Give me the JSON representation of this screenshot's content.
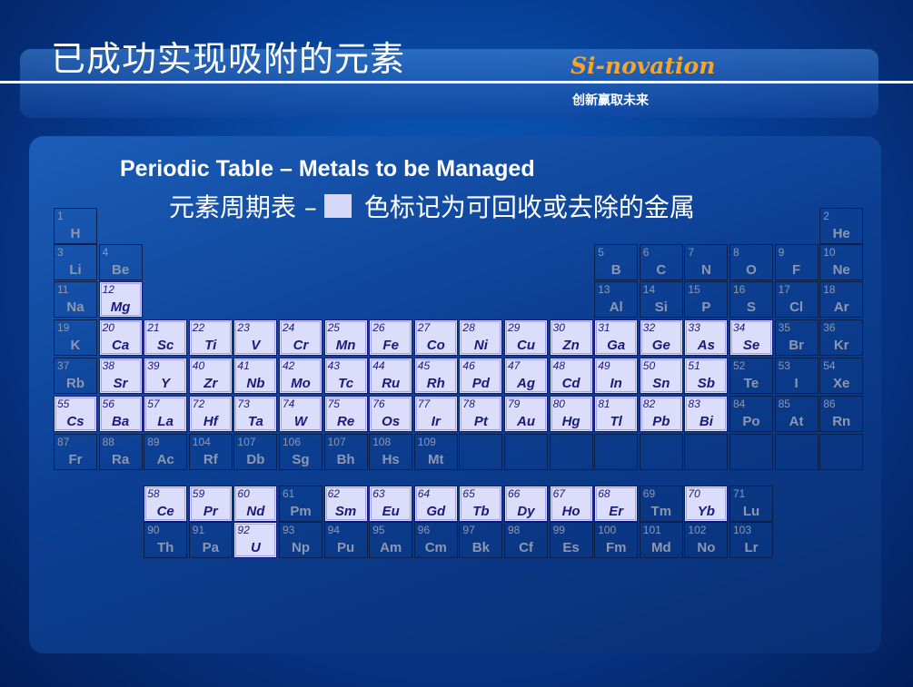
{
  "slide": {
    "title": "已成功实现吸附的元素",
    "brand": "Si-novation",
    "slogan": "创新赢取未来",
    "heading_en": "Periodic Table – Metals to be Managed",
    "heading_cn_left": "元素周期表 –",
    "heading_cn_right": "色标记为可回收或去除的金属"
  },
  "colors": {
    "highlight_fill": "#dcdcfb",
    "highlight_text": "#1a1a7a",
    "dim_text": "#8d98b0",
    "brand": "#f5a52a"
  },
  "elements": [
    {
      "n": "1",
      "s": "H",
      "r": 0,
      "c": 0,
      "hl": false
    },
    {
      "n": "2",
      "s": "He",
      "r": 0,
      "c": 17,
      "hl": false
    },
    {
      "n": "3",
      "s": "Li",
      "r": 1,
      "c": 0,
      "hl": false
    },
    {
      "n": "4",
      "s": "Be",
      "r": 1,
      "c": 1,
      "hl": false
    },
    {
      "n": "5",
      "s": "B",
      "r": 1,
      "c": 12,
      "hl": false
    },
    {
      "n": "6",
      "s": "C",
      "r": 1,
      "c": 13,
      "hl": false
    },
    {
      "n": "7",
      "s": "N",
      "r": 1,
      "c": 14,
      "hl": false
    },
    {
      "n": "8",
      "s": "O",
      "r": 1,
      "c": 15,
      "hl": false
    },
    {
      "n": "9",
      "s": "F",
      "r": 1,
      "c": 16,
      "hl": false
    },
    {
      "n": "10",
      "s": "Ne",
      "r": 1,
      "c": 17,
      "hl": false
    },
    {
      "n": "11",
      "s": "Na",
      "r": 2,
      "c": 0,
      "hl": false
    },
    {
      "n": "12",
      "s": "Mg",
      "r": 2,
      "c": 1,
      "hl": true
    },
    {
      "n": "13",
      "s": "Al",
      "r": 2,
      "c": 12,
      "hl": false
    },
    {
      "n": "14",
      "s": "Si",
      "r": 2,
      "c": 13,
      "hl": false
    },
    {
      "n": "15",
      "s": "P",
      "r": 2,
      "c": 14,
      "hl": false
    },
    {
      "n": "16",
      "s": "S",
      "r": 2,
      "c": 15,
      "hl": false
    },
    {
      "n": "17",
      "s": "Cl",
      "r": 2,
      "c": 16,
      "hl": false
    },
    {
      "n": "18",
      "s": "Ar",
      "r": 2,
      "c": 17,
      "hl": false
    },
    {
      "n": "19",
      "s": "K",
      "r": 3,
      "c": 0,
      "hl": false
    },
    {
      "n": "20",
      "s": "Ca",
      "r": 3,
      "c": 1,
      "hl": true
    },
    {
      "n": "21",
      "s": "Sc",
      "r": 3,
      "c": 2,
      "hl": true
    },
    {
      "n": "22",
      "s": "Ti",
      "r": 3,
      "c": 3,
      "hl": true
    },
    {
      "n": "23",
      "s": "V",
      "r": 3,
      "c": 4,
      "hl": true
    },
    {
      "n": "24",
      "s": "Cr",
      "r": 3,
      "c": 5,
      "hl": true
    },
    {
      "n": "25",
      "s": "Mn",
      "r": 3,
      "c": 6,
      "hl": true
    },
    {
      "n": "26",
      "s": "Fe",
      "r": 3,
      "c": 7,
      "hl": true
    },
    {
      "n": "27",
      "s": "Co",
      "r": 3,
      "c": 8,
      "hl": true
    },
    {
      "n": "28",
      "s": "Ni",
      "r": 3,
      "c": 9,
      "hl": true
    },
    {
      "n": "29",
      "s": "Cu",
      "r": 3,
      "c": 10,
      "hl": true
    },
    {
      "n": "30",
      "s": "Zn",
      "r": 3,
      "c": 11,
      "hl": true
    },
    {
      "n": "31",
      "s": "Ga",
      "r": 3,
      "c": 12,
      "hl": true
    },
    {
      "n": "32",
      "s": "Ge",
      "r": 3,
      "c": 13,
      "hl": true
    },
    {
      "n": "33",
      "s": "As",
      "r": 3,
      "c": 14,
      "hl": true
    },
    {
      "n": "34",
      "s": "Se",
      "r": 3,
      "c": 15,
      "hl": true
    },
    {
      "n": "35",
      "s": "Br",
      "r": 3,
      "c": 16,
      "hl": false
    },
    {
      "n": "36",
      "s": "Kr",
      "r": 3,
      "c": 17,
      "hl": false
    },
    {
      "n": "37",
      "s": "Rb",
      "r": 4,
      "c": 0,
      "hl": false
    },
    {
      "n": "38",
      "s": "Sr",
      "r": 4,
      "c": 1,
      "hl": true
    },
    {
      "n": "39",
      "s": "Y",
      "r": 4,
      "c": 2,
      "hl": true
    },
    {
      "n": "40",
      "s": "Zr",
      "r": 4,
      "c": 3,
      "hl": true
    },
    {
      "n": "41",
      "s": "Nb",
      "r": 4,
      "c": 4,
      "hl": true
    },
    {
      "n": "42",
      "s": "Mo",
      "r": 4,
      "c": 5,
      "hl": true
    },
    {
      "n": "43",
      "s": "Tc",
      "r": 4,
      "c": 6,
      "hl": true
    },
    {
      "n": "44",
      "s": "Ru",
      "r": 4,
      "c": 7,
      "hl": true
    },
    {
      "n": "45",
      "s": "Rh",
      "r": 4,
      "c": 8,
      "hl": true
    },
    {
      "n": "46",
      "s": "Pd",
      "r": 4,
      "c": 9,
      "hl": true
    },
    {
      "n": "47",
      "s": "Ag",
      "r": 4,
      "c": 10,
      "hl": true
    },
    {
      "n": "48",
      "s": "Cd",
      "r": 4,
      "c": 11,
      "hl": true
    },
    {
      "n": "49",
      "s": "In",
      "r": 4,
      "c": 12,
      "hl": true
    },
    {
      "n": "50",
      "s": "Sn",
      "r": 4,
      "c": 13,
      "hl": true
    },
    {
      "n": "51",
      "s": "Sb",
      "r": 4,
      "c": 14,
      "hl": true
    },
    {
      "n": "52",
      "s": "Te",
      "r": 4,
      "c": 15,
      "hl": false
    },
    {
      "n": "53",
      "s": "I",
      "r": 4,
      "c": 16,
      "hl": false
    },
    {
      "n": "54",
      "s": "Xe",
      "r": 4,
      "c": 17,
      "hl": false
    },
    {
      "n": "55",
      "s": "Cs",
      "r": 5,
      "c": 0,
      "hl": true
    },
    {
      "n": "56",
      "s": "Ba",
      "r": 5,
      "c": 1,
      "hl": true
    },
    {
      "n": "57",
      "s": "La",
      "r": 5,
      "c": 2,
      "hl": true
    },
    {
      "n": "72",
      "s": "Hf",
      "r": 5,
      "c": 3,
      "hl": true
    },
    {
      "n": "73",
      "s": "Ta",
      "r": 5,
      "c": 4,
      "hl": true
    },
    {
      "n": "74",
      "s": "W",
      "r": 5,
      "c": 5,
      "hl": true
    },
    {
      "n": "75",
      "s": "Re",
      "r": 5,
      "c": 6,
      "hl": true
    },
    {
      "n": "76",
      "s": "Os",
      "r": 5,
      "c": 7,
      "hl": true
    },
    {
      "n": "77",
      "s": "Ir",
      "r": 5,
      "c": 8,
      "hl": true
    },
    {
      "n": "78",
      "s": "Pt",
      "r": 5,
      "c": 9,
      "hl": true
    },
    {
      "n": "79",
      "s": "Au",
      "r": 5,
      "c": 10,
      "hl": true
    },
    {
      "n": "80",
      "s": "Hg",
      "r": 5,
      "c": 11,
      "hl": true
    },
    {
      "n": "81",
      "s": "Tl",
      "r": 5,
      "c": 12,
      "hl": true
    },
    {
      "n": "82",
      "s": "Pb",
      "r": 5,
      "c": 13,
      "hl": true
    },
    {
      "n": "83",
      "s": "Bi",
      "r": 5,
      "c": 14,
      "hl": true
    },
    {
      "n": "84",
      "s": "Po",
      "r": 5,
      "c": 15,
      "hl": false
    },
    {
      "n": "85",
      "s": "At",
      "r": 5,
      "c": 16,
      "hl": false
    },
    {
      "n": "86",
      "s": "Rn",
      "r": 5,
      "c": 17,
      "hl": false
    },
    {
      "n": "87",
      "s": "Fr",
      "r": 6,
      "c": 0,
      "hl": false
    },
    {
      "n": "88",
      "s": "Ra",
      "r": 6,
      "c": 1,
      "hl": false
    },
    {
      "n": "89",
      "s": "Ac",
      "r": 6,
      "c": 2,
      "hl": false
    },
    {
      "n": "104",
      "s": "Rf",
      "r": 6,
      "c": 3,
      "hl": false
    },
    {
      "n": "107",
      "s": "Db",
      "r": 6,
      "c": 4,
      "hl": false
    },
    {
      "n": "106",
      "s": "Sg",
      "r": 6,
      "c": 5,
      "hl": false
    },
    {
      "n": "107",
      "s": "Bh",
      "r": 6,
      "c": 6,
      "hl": false
    },
    {
      "n": "108",
      "s": "Hs",
      "r": 6,
      "c": 7,
      "hl": false
    },
    {
      "n": "109",
      "s": "Mt",
      "r": 6,
      "c": 8,
      "hl": false
    },
    {
      "n": "",
      "s": "",
      "r": 6,
      "c": 9,
      "hl": false
    },
    {
      "n": "",
      "s": "",
      "r": 6,
      "c": 10,
      "hl": false
    },
    {
      "n": "",
      "s": "",
      "r": 6,
      "c": 11,
      "hl": false
    },
    {
      "n": "",
      "s": "",
      "r": 6,
      "c": 12,
      "hl": false
    },
    {
      "n": "",
      "s": "",
      "r": 6,
      "c": 13,
      "hl": false
    },
    {
      "n": "",
      "s": "",
      "r": 6,
      "c": 14,
      "hl": false
    },
    {
      "n": "",
      "s": "",
      "r": 6,
      "c": 15,
      "hl": false
    },
    {
      "n": "",
      "s": "",
      "r": 6,
      "c": 16,
      "hl": false
    },
    {
      "n": "",
      "s": "",
      "r": 6,
      "c": 17,
      "hl": false
    },
    {
      "n": "58",
      "s": "Ce",
      "r": 7,
      "c": 2,
      "hl": true
    },
    {
      "n": "59",
      "s": "Pr",
      "r": 7,
      "c": 3,
      "hl": true
    },
    {
      "n": "60",
      "s": "Nd",
      "r": 7,
      "c": 4,
      "hl": true
    },
    {
      "n": "61",
      "s": "Pm",
      "r": 7,
      "c": 5,
      "hl": false
    },
    {
      "n": "62",
      "s": "Sm",
      "r": 7,
      "c": 6,
      "hl": true
    },
    {
      "n": "63",
      "s": "Eu",
      "r": 7,
      "c": 7,
      "hl": true
    },
    {
      "n": "64",
      "s": "Gd",
      "r": 7,
      "c": 8,
      "hl": true
    },
    {
      "n": "65",
      "s": "Tb",
      "r": 7,
      "c": 9,
      "hl": true
    },
    {
      "n": "66",
      "s": "Dy",
      "r": 7,
      "c": 10,
      "hl": true
    },
    {
      "n": "67",
      "s": "Ho",
      "r": 7,
      "c": 11,
      "hl": true
    },
    {
      "n": "68",
      "s": "Er",
      "r": 7,
      "c": 12,
      "hl": true
    },
    {
      "n": "69",
      "s": "Tm",
      "r": 7,
      "c": 13,
      "hl": false
    },
    {
      "n": "70",
      "s": "Yb",
      "r": 7,
      "c": 14,
      "hl": true
    },
    {
      "n": "71",
      "s": "Lu",
      "r": 7,
      "c": 15,
      "hl": false
    },
    {
      "n": "90",
      "s": "Th",
      "r": 8,
      "c": 2,
      "hl": false
    },
    {
      "n": "91",
      "s": "Pa",
      "r": 8,
      "c": 3,
      "hl": false
    },
    {
      "n": "92",
      "s": "U",
      "r": 8,
      "c": 4,
      "hl": true
    },
    {
      "n": "93",
      "s": "Np",
      "r": 8,
      "c": 5,
      "hl": false
    },
    {
      "n": "94",
      "s": "Pu",
      "r": 8,
      "c": 6,
      "hl": false
    },
    {
      "n": "95",
      "s": "Am",
      "r": 8,
      "c": 7,
      "hl": false
    },
    {
      "n": "96",
      "s": "Cm",
      "r": 8,
      "c": 8,
      "hl": false
    },
    {
      "n": "97",
      "s": "Bk",
      "r": 8,
      "c": 9,
      "hl": false
    },
    {
      "n": "98",
      "s": "Cf",
      "r": 8,
      "c": 10,
      "hl": false
    },
    {
      "n": "99",
      "s": "Es",
      "r": 8,
      "c": 11,
      "hl": false
    },
    {
      "n": "100",
      "s": "Fm",
      "r": 8,
      "c": 12,
      "hl": false
    },
    {
      "n": "101",
      "s": "Md",
      "r": 8,
      "c": 13,
      "hl": false
    },
    {
      "n": "102",
      "s": "No",
      "r": 8,
      "c": 14,
      "hl": false
    },
    {
      "n": "103",
      "s": "Lr",
      "r": 8,
      "c": 15,
      "hl": false
    }
  ]
}
